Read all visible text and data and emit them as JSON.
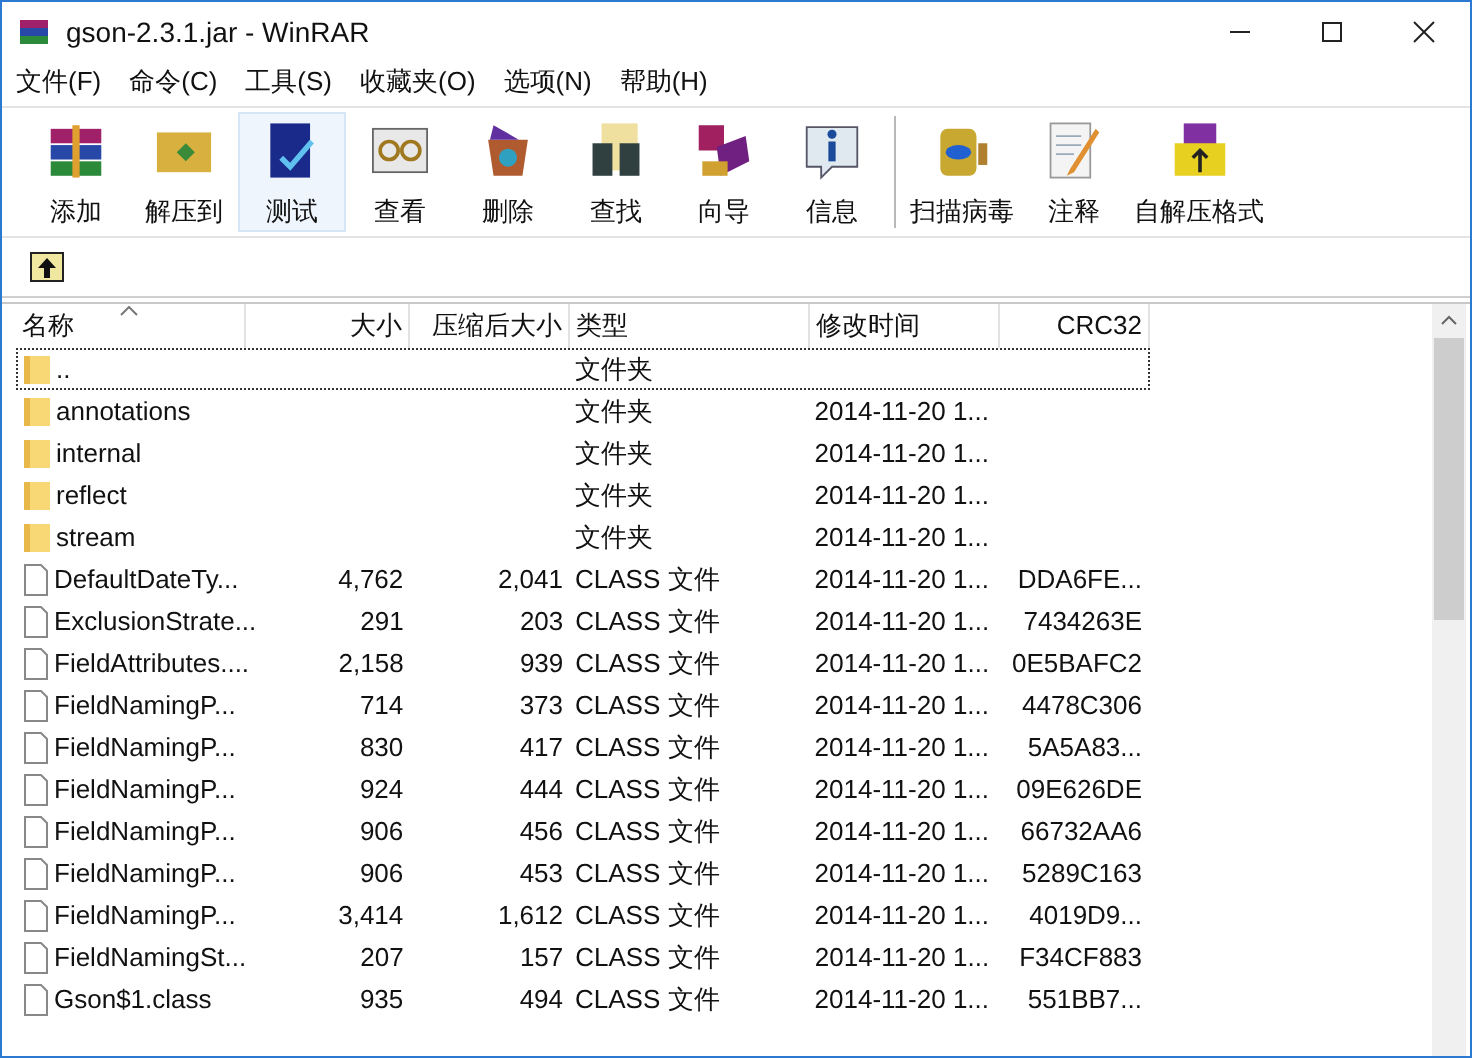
{
  "window": {
    "title": "gson-2.3.1.jar - WinRAR"
  },
  "menu": [
    "文件(F)",
    "命令(C)",
    "工具(S)",
    "收藏夹(O)",
    "选项(N)",
    "帮助(H)"
  ],
  "toolbar": {
    "groups": [
      [
        {
          "label": "添加",
          "highlighted": false
        },
        {
          "label": "解压到",
          "highlighted": false
        },
        {
          "label": "测试",
          "highlighted": true
        },
        {
          "label": "查看",
          "highlighted": false
        },
        {
          "label": "删除",
          "highlighted": false
        },
        {
          "label": "查找",
          "highlighted": false
        },
        {
          "label": "向导",
          "highlighted": false
        },
        {
          "label": "信息",
          "highlighted": false
        }
      ],
      [
        {
          "label": "扫描病毒",
          "highlighted": false
        },
        {
          "label": "注释",
          "highlighted": false
        },
        {
          "label": "自解压格式",
          "highlighted": false
        }
      ]
    ]
  },
  "table": {
    "columns": [
      {
        "label": "名称",
        "sorted": true
      },
      {
        "label": "大小",
        "sorted": false
      },
      {
        "label": "压缩后大小",
        "sorted": false
      },
      {
        "label": "类型",
        "sorted": false
      },
      {
        "label": "修改时间",
        "sorted": false
      },
      {
        "label": "CRC32",
        "sorted": false
      }
    ],
    "rows": [
      {
        "kind": "folder",
        "focused": true,
        "cells": [
          "..",
          "",
          "",
          "文件夹",
          "",
          ""
        ]
      },
      {
        "kind": "folder",
        "focused": false,
        "cells": [
          "annotations",
          "",
          "",
          "文件夹",
          "2014-11-20 1...",
          ""
        ]
      },
      {
        "kind": "folder",
        "focused": false,
        "cells": [
          "internal",
          "",
          "",
          "文件夹",
          "2014-11-20 1...",
          ""
        ]
      },
      {
        "kind": "folder",
        "focused": false,
        "cells": [
          "reflect",
          "",
          "",
          "文件夹",
          "2014-11-20 1...",
          ""
        ]
      },
      {
        "kind": "folder",
        "focused": false,
        "cells": [
          "stream",
          "",
          "",
          "文件夹",
          "2014-11-20 1...",
          ""
        ]
      },
      {
        "kind": "file",
        "focused": false,
        "cells": [
          "DefaultDateTy...",
          "4,762",
          "2,041",
          "CLASS 文件",
          "2014-11-20 1...",
          "DDA6FE..."
        ]
      },
      {
        "kind": "file",
        "focused": false,
        "cells": [
          "ExclusionStrate...",
          "291",
          "203",
          "CLASS 文件",
          "2014-11-20 1...",
          "7434263E"
        ]
      },
      {
        "kind": "file",
        "focused": false,
        "cells": [
          "FieldAttributes....",
          "2,158",
          "939",
          "CLASS 文件",
          "2014-11-20 1...",
          "0E5BAFC2"
        ]
      },
      {
        "kind": "file",
        "focused": false,
        "cells": [
          "FieldNamingP...",
          "714",
          "373",
          "CLASS 文件",
          "2014-11-20 1...",
          "4478C306"
        ]
      },
      {
        "kind": "file",
        "focused": false,
        "cells": [
          "FieldNamingP...",
          "830",
          "417",
          "CLASS 文件",
          "2014-11-20 1...",
          "5A5A83..."
        ]
      },
      {
        "kind": "file",
        "focused": false,
        "cells": [
          "FieldNamingP...",
          "924",
          "444",
          "CLASS 文件",
          "2014-11-20 1...",
          "09E626DE"
        ]
      },
      {
        "kind": "file",
        "focused": false,
        "cells": [
          "FieldNamingP...",
          "906",
          "456",
          "CLASS 文件",
          "2014-11-20 1...",
          "66732AA6"
        ]
      },
      {
        "kind": "file",
        "focused": false,
        "cells": [
          "FieldNamingP...",
          "906",
          "453",
          "CLASS 文件",
          "2014-11-20 1...",
          "5289C163"
        ]
      },
      {
        "kind": "file",
        "focused": false,
        "cells": [
          "FieldNamingP...",
          "3,414",
          "1,612",
          "CLASS 文件",
          "2014-11-20 1...",
          "4019D9..."
        ]
      },
      {
        "kind": "file",
        "focused": false,
        "cells": [
          "FieldNamingSt...",
          "207",
          "157",
          "CLASS 文件",
          "2014-11-20 1...",
          "F34CF883"
        ]
      },
      {
        "kind": "file",
        "focused": false,
        "cells": [
          "Gson$1.class",
          "935",
          "494",
          "CLASS 文件",
          "2014-11-20 1...",
          "551BB7..."
        ]
      }
    ]
  }
}
